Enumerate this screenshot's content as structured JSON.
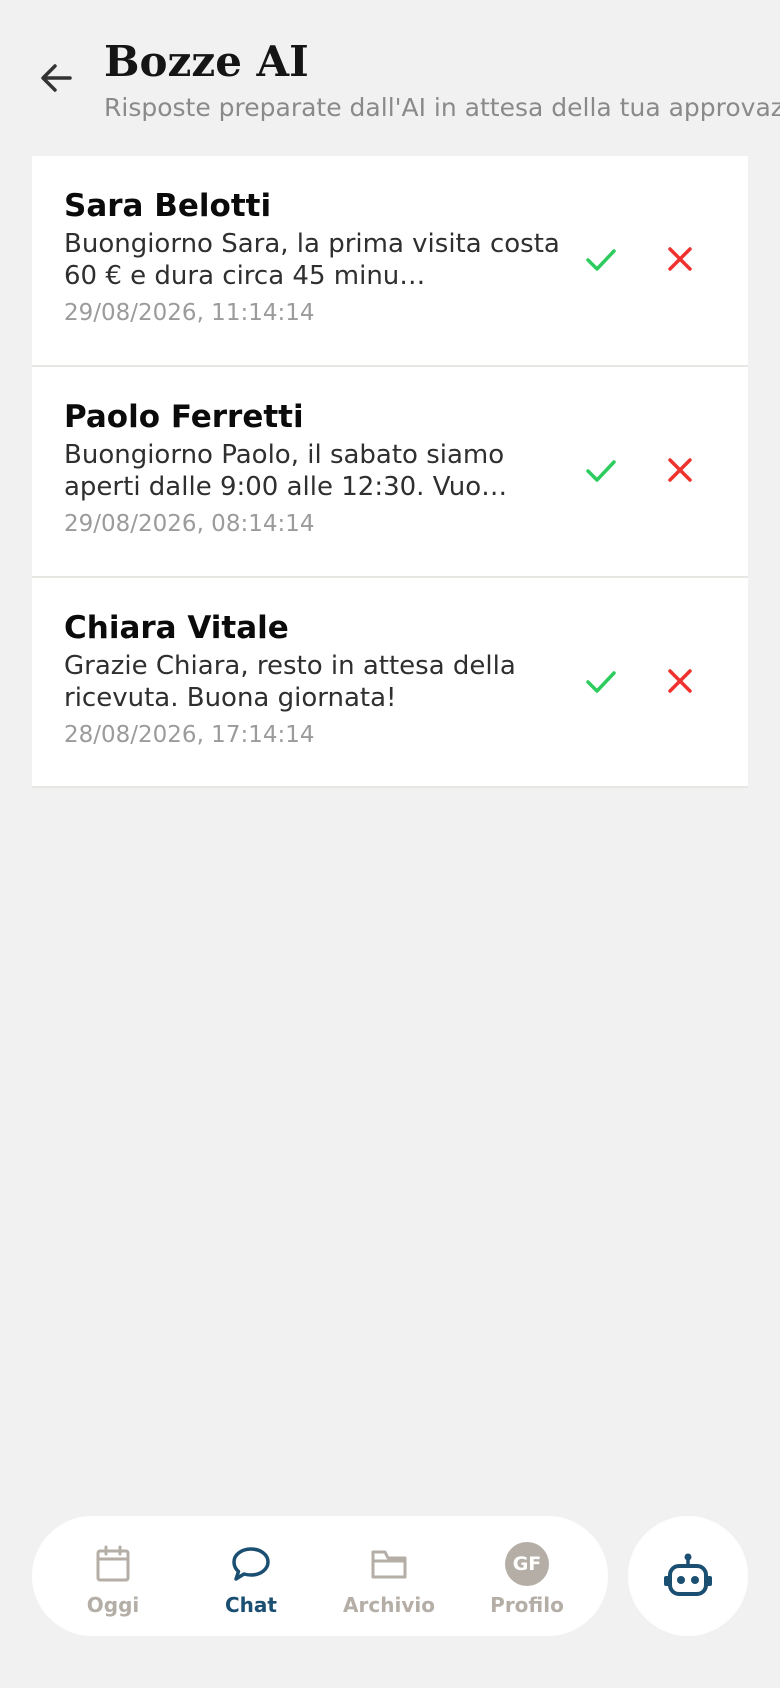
{
  "header": {
    "title": "Bozze AI",
    "subtitle": "Risposte preparate dall'AI in attesa della tua approvazione"
  },
  "drafts": [
    {
      "name": "Sara Belotti",
      "preview": "Buongiorno Sara, la prima visita costa 60 € e dura circa 45 minu…",
      "time": "29/08/2026, 11:14:14"
    },
    {
      "name": "Paolo Ferretti",
      "preview": "Buongiorno Paolo, il sabato siamo aperti dalle 9:00 alle 12:30. Vuo…",
      "time": "29/08/2026, 08:14:14"
    },
    {
      "name": "Chiara Vitale",
      "preview": "Grazie Chiara, resto in attesa della ricevuta. Buona giornata!",
      "time": "28/08/2026, 17:14:14"
    }
  ],
  "nav": {
    "items": [
      {
        "label": "Oggi",
        "icon": "calendar-icon"
      },
      {
        "label": "Chat",
        "icon": "chat-bubble-icon"
      },
      {
        "label": "Archivio",
        "icon": "folder-icon"
      },
      {
        "label": "Profilo",
        "icon": "avatar"
      }
    ],
    "active": "Chat",
    "avatar_initials": "GF",
    "fab_icon": "robot-icon"
  },
  "colors": {
    "accent": "#1b4f72",
    "approve": "#2ecc5f",
    "reject": "#f0322e",
    "inactive": "#b4aea6",
    "background": "#f1f1f1"
  }
}
